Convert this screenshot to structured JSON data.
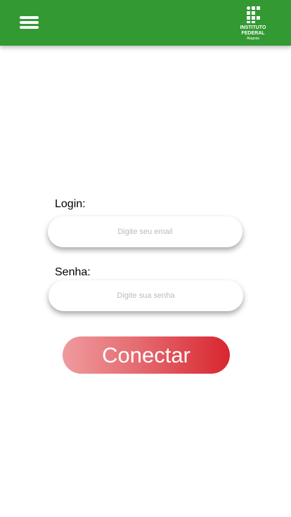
{
  "header": {
    "menu_icon": "hamburger-menu-icon",
    "background_color": "#339933",
    "logo": {
      "line1": "INSTITUTO",
      "line2": "FEDERAL",
      "line3": "Alagoas"
    }
  },
  "form": {
    "login_label": "Login:",
    "login_placeholder": "Digite seu email",
    "login_value": "",
    "password_label": "Senha:",
    "password_placeholder": "Digite sua senha",
    "password_value": "",
    "submit_label": "Conectar",
    "submit_color": "#d8262f"
  }
}
